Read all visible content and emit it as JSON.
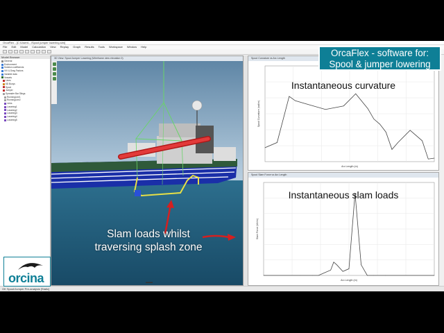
{
  "app": {
    "title": "OrcaFlex - [C:\\Users\\...\\Spool jumper lowering.sim]",
    "menu": [
      "File",
      "Edit",
      "Model",
      "Calculation",
      "View",
      "Replay",
      "Graph",
      "Results",
      "Tools",
      "Workspace",
      "Window",
      "Help"
    ],
    "status": "OK  Spool/Jumper Pre-analysis [Static]"
  },
  "explorer": {
    "title": "Model Browser",
    "items": [
      "General",
      "Environment",
      "Solution coefficients",
      "VIV & Drag Factors",
      "Variable data",
      "Vessels",
      "Lines",
      "6D Buoys",
      "Spool",
      "Jumper",
      "Spreader Bar Slings",
      "RunningLine1",
      "RunningLine2",
      "Links",
      "Lowering1",
      "Lowering2",
      "Lowering3",
      "Lowering4",
      "Lowering5"
    ]
  },
  "view3d": {
    "title": "3D View: Spool Jumper Lowering (Wireframe view elevation 0)"
  },
  "banner": {
    "line1": "OrcaFlex - software for:",
    "line2": "Spool & jumper lowering"
  },
  "annotation": {
    "line1": "Slam loads whilst",
    "line2": "traversing splash zone"
  },
  "logo": {
    "text": "orcina"
  },
  "plots": {
    "curvature": {
      "window_title": "Spool Curvature vs Arc Length",
      "title": "Instantaneous curvature"
    },
    "slam": {
      "window_title": "Spool Slam Force vs Arc Length",
      "title": "Instantaneous slam loads"
    }
  },
  "colors": {
    "brand": "#0e7f96",
    "sea": "#1f5a7a",
    "sky": "#9db9cf",
    "annotation_arrow": "#d42020"
  },
  "chart_data": [
    {
      "type": "line",
      "title": "Instantaneous curvature",
      "xlabel": "Arc Length (m)",
      "ylabel": "Spool Curvature (rad/m)",
      "x": [
        0,
        2,
        4,
        5,
        7,
        10,
        13,
        15,
        17,
        18,
        19,
        20,
        21,
        22,
        24,
        26,
        27,
        28
      ],
      "y": [
        0.0016,
        0.0022,
        0.0075,
        0.007,
        0.0066,
        0.006,
        0.0064,
        0.0078,
        0.0061,
        0.0049,
        0.0043,
        0.0034,
        0.0014,
        0.0022,
        0.0036,
        0.0024,
        0.0003,
        0.0004
      ],
      "ylim": [
        0,
        0.011
      ],
      "grid": true
    },
    {
      "type": "line",
      "title": "Instantaneous slam loads",
      "xlabel": "Arc Length (m)",
      "ylabel": "Slam Force (kN/m)",
      "x": [
        0,
        6,
        8,
        9,
        10,
        11,
        11.5,
        12,
        13,
        14,
        15,
        16,
        17,
        18,
        20,
        28
      ],
      "y": [
        0,
        0,
        0,
        0,
        0.2,
        0.4,
        1.0,
        0.8,
        0.3,
        0.5,
        6.2,
        0.8,
        0,
        0,
        0,
        0
      ],
      "ylim": [
        0,
        7
      ],
      "grid": true
    }
  ]
}
